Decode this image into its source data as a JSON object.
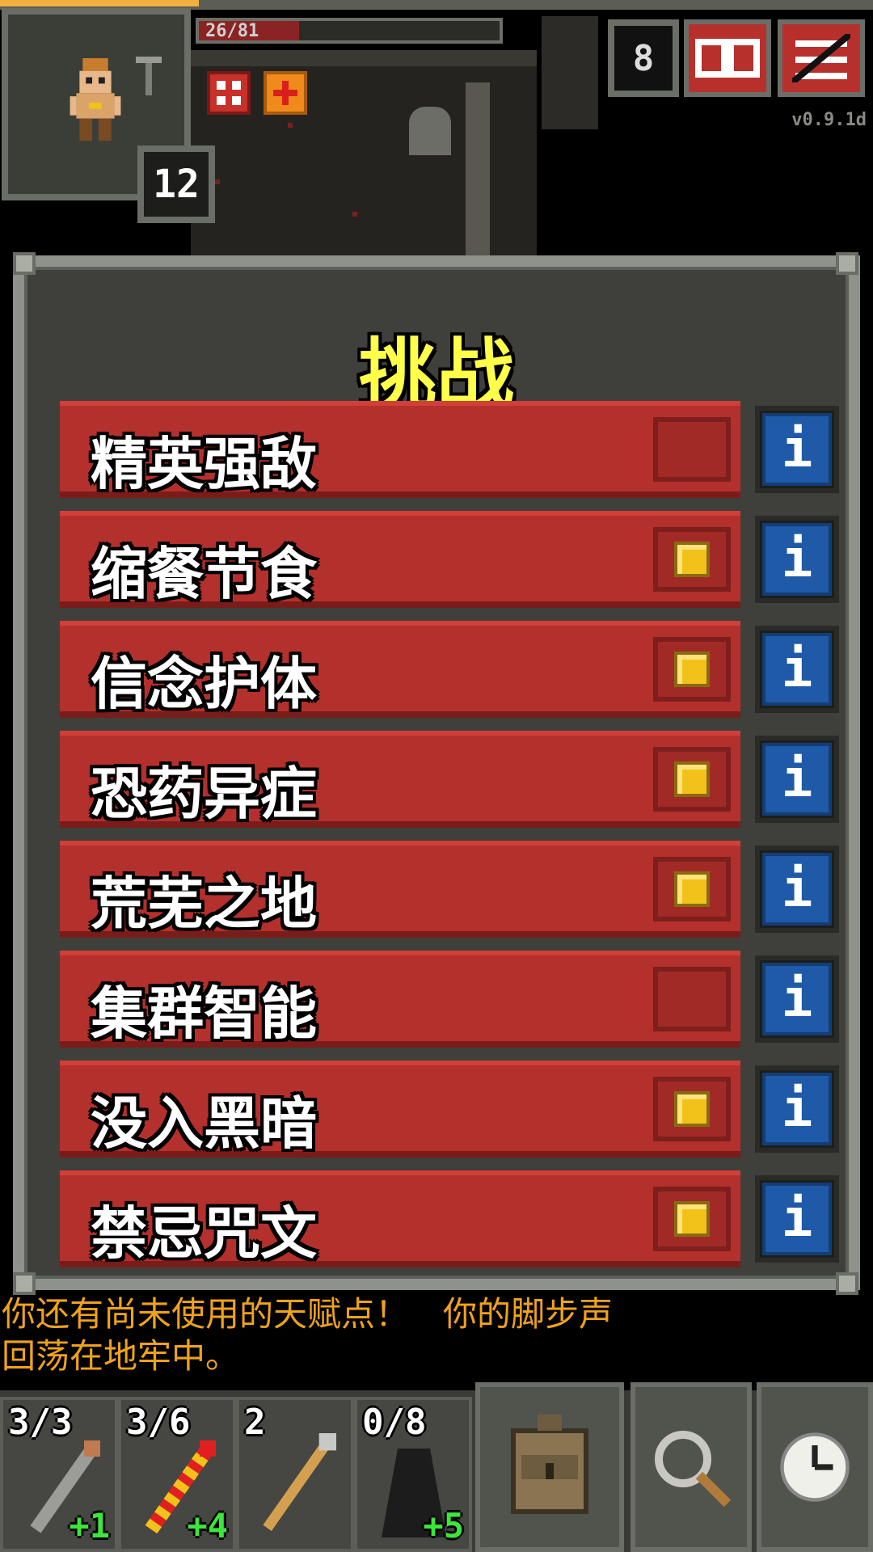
{
  "hud": {
    "hp_text": "26/81",
    "level": "12",
    "depth_counter": "8",
    "version": "v0.9.1d"
  },
  "challenges": {
    "title": "挑战",
    "items": [
      {
        "label": "精英强敌",
        "checked": false
      },
      {
        "label": "缩餐节食",
        "checked": true
      },
      {
        "label": "信念护体",
        "checked": true
      },
      {
        "label": "恐药异症",
        "checked": true
      },
      {
        "label": "荒芜之地",
        "checked": true
      },
      {
        "label": "集群智能",
        "checked": false
      },
      {
        "label": "没入黑暗",
        "checked": true
      },
      {
        "label": "禁忌咒文",
        "checked": true
      }
    ],
    "info_glyph": "i"
  },
  "log": {
    "line1": "你还有尚未使用的天赋点！　你的脚步声",
    "line2": "回荡在地牢中。"
  },
  "quickslots": [
    {
      "count": "3/3",
      "bonus": "+1",
      "icon": "wand-gray-icon"
    },
    {
      "count": "3/6",
      "bonus": "+4",
      "icon": "wand-striped-icon"
    },
    {
      "count": "2",
      "bonus": "",
      "icon": "spear-icon"
    },
    {
      "count": "0/8",
      "bonus": "+5",
      "icon": "cloak-icon"
    }
  ],
  "toolbar": {
    "backpack_icon": "backpack-icon",
    "search_icon": "magnifier-icon",
    "wait_icon": "clock-icon"
  },
  "colors": {
    "title": "#ffff4a",
    "row": "#b4302c",
    "info": "#1e5aa8",
    "log": "#f0a21a",
    "bonus": "#3ce63c"
  }
}
